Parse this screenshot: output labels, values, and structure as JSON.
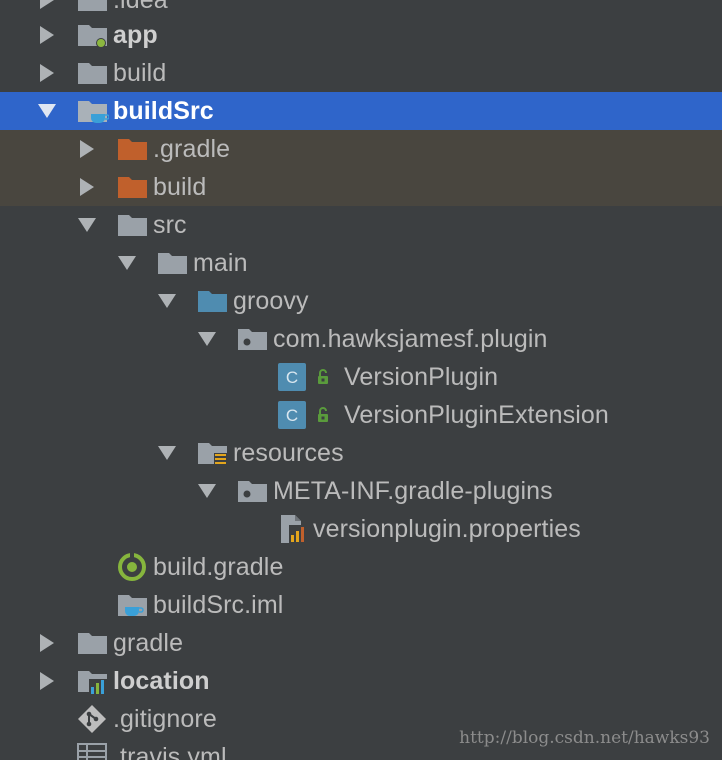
{
  "tree": {
    "items": [
      {
        "label": ".idea",
        "icon": "folder-icon",
        "expanded": false
      },
      {
        "label": "app",
        "icon": "module-folder-icon",
        "expanded": false
      },
      {
        "label": "build",
        "icon": "folder-icon",
        "expanded": false
      },
      {
        "label": "buildSrc",
        "icon": "module-folder-icon",
        "expanded": true,
        "selected": true
      },
      {
        "label": ".gradle",
        "icon": "excluded-folder-icon",
        "expanded": false
      },
      {
        "label": "build",
        "icon": "excluded-folder-icon",
        "expanded": false
      },
      {
        "label": "src",
        "icon": "folder-icon",
        "expanded": true
      },
      {
        "label": "main",
        "icon": "folder-icon",
        "expanded": true
      },
      {
        "label": "groovy",
        "icon": "source-root-folder-icon",
        "expanded": true
      },
      {
        "label": "com.hawksjamesf.plugin",
        "icon": "package-icon",
        "expanded": true
      },
      {
        "label": "VersionPlugin",
        "icon": "groovy-class-icon"
      },
      {
        "label": "VersionPluginExtension",
        "icon": "groovy-class-icon"
      },
      {
        "label": "resources",
        "icon": "resources-folder-icon",
        "expanded": true
      },
      {
        "label": "META-INF.gradle-plugins",
        "icon": "package-icon",
        "expanded": true
      },
      {
        "label": "versionplugin.properties",
        "icon": "properties-file-icon"
      },
      {
        "label": "build.gradle",
        "icon": "gradle-file-icon"
      },
      {
        "label": "buildSrc.iml",
        "icon": "iml-file-icon"
      },
      {
        "label": "gradle",
        "icon": "folder-icon",
        "expanded": false
      },
      {
        "label": "location",
        "icon": "chart-folder-icon",
        "expanded": false
      },
      {
        "label": ".gitignore",
        "icon": "gitignore-file-icon"
      },
      {
        "label": ".travis.yml",
        "icon": "yaml-file-icon"
      }
    ]
  },
  "colors": {
    "background": "#3c3f41",
    "selection": "#2f65ca",
    "excluded_bg": "#49463f",
    "folder": "#9aa1a8",
    "excluded_folder": "#c0602c",
    "source_folder": "#4f8cb0",
    "class_icon": "#4f8cb0"
  },
  "watermark": "http://blog.csdn.net/hawks93"
}
